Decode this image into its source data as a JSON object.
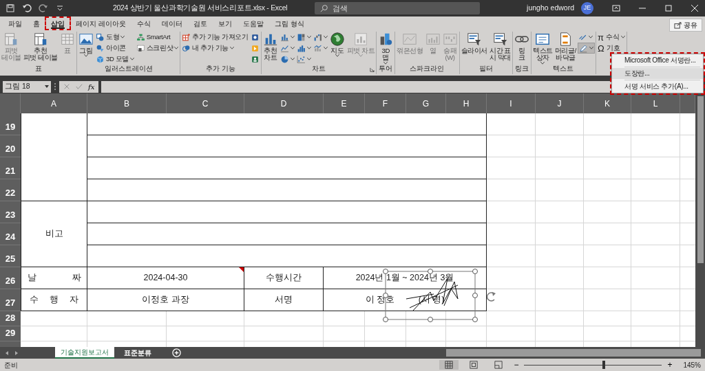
{
  "title_bar": {
    "title": "2024 상반기 울산과학기술원 서비스리포트.xlsx  -  Excel",
    "search_placeholder": "검색",
    "user_name": "jungho edword",
    "avatar_initials": "JE"
  },
  "ribbon_tabs": [
    {
      "label": "파일",
      "selected": false,
      "marked": false
    },
    {
      "label": "홈",
      "selected": false,
      "marked": false
    },
    {
      "label": "삽입",
      "selected": true,
      "marked": true
    },
    {
      "label": "페이지 레이아웃",
      "selected": false,
      "marked": false
    },
    {
      "label": "수식",
      "selected": false,
      "marked": false
    },
    {
      "label": "데이터",
      "selected": false,
      "marked": false
    },
    {
      "label": "검토",
      "selected": false,
      "marked": false
    },
    {
      "label": "보기",
      "selected": false,
      "marked": false
    },
    {
      "label": "도움말",
      "selected": false,
      "marked": false
    },
    {
      "label": "그림 형식",
      "selected": false,
      "marked": false
    }
  ],
  "share_button": "공유",
  "ribbon_groups": [
    {
      "label": "표",
      "items": [
        {
          "kind": "large",
          "label": "피벗\n테이블",
          "disabled": true,
          "dropdown": false
        },
        {
          "kind": "large",
          "label": "추천\n피벗 테이블",
          "disabled": false,
          "dropdown": false
        },
        {
          "kind": "large",
          "label": "표",
          "disabled": true,
          "dropdown": false
        }
      ]
    },
    {
      "label": "일러스트레이션",
      "items": [
        {
          "kind": "large",
          "label": "그림",
          "disabled": false,
          "dropdown": true
        },
        {
          "kind": "stack",
          "items": [
            {
              "label": "도형",
              "dropdown": true,
              "pressed": false
            },
            {
              "label": "아이콘",
              "dropdown": false,
              "pressed": false
            },
            {
              "label": "3D 모델",
              "dropdown": true,
              "pressed": false
            }
          ]
        },
        {
          "kind": "stack",
          "items": [
            {
              "label": "SmartArt",
              "dropdown": false,
              "pressed": false
            },
            {
              "label": "스크린샷",
              "dropdown": true,
              "pressed": false
            }
          ]
        }
      ]
    },
    {
      "label": "추가 기능",
      "items": [
        {
          "kind": "stack",
          "items": [
            {
              "label": "추가 기능 가져오기",
              "dropdown": false,
              "pressed": false
            },
            {
              "label": "내 추가 기능",
              "dropdown": true,
              "pressed": false
            }
          ]
        },
        {
          "kind": "stack",
          "items": [
            {
              "dropdown": false,
              "pressed": false
            },
            {
              "dropdown": false,
              "pressed": false
            },
            {
              "dropdown": false,
              "pressed": false
            }
          ]
        }
      ]
    },
    {
      "label": "차트",
      "launcher": true,
      "items": [
        {
          "kind": "large",
          "label": "추천\n차트",
          "disabled": false,
          "dropdown": false
        },
        {
          "kind": "stack",
          "items": [
            {
              "dropdown": true,
              "pressed": false
            },
            {
              "dropdown": true,
              "pressed": false
            },
            {
              "dropdown": true,
              "pressed": false
            }
          ]
        },
        {
          "kind": "stack",
          "items": [
            {
              "dropdown": true,
              "pressed": false
            },
            {
              "dropdown": true,
              "pressed": false
            },
            {
              "dropdown": true,
              "pressed": false
            }
          ]
        },
        {
          "kind": "stack",
          "items": [
            {
              "dropdown": true,
              "pressed": false
            },
            {
              "dropdown": true,
              "pressed": false
            }
          ]
        },
        {
          "kind": "large",
          "label": "지도",
          "disabled": false,
          "dropdown": true
        },
        {
          "kind": "large",
          "label": "피벗 차트",
          "disabled": true,
          "dropdown": true
        }
      ]
    },
    {
      "label": "투어",
      "items": [
        {
          "kind": "large",
          "label": "3D\n맵",
          "disabled": false,
          "dropdown": true
        }
      ]
    },
    {
      "label": "스파크라인",
      "items": [
        {
          "kind": "large",
          "label": "꺾은선형",
          "disabled": true,
          "dropdown": false
        },
        {
          "kind": "large",
          "label": "열",
          "disabled": true,
          "dropdown": false
        },
        {
          "kind": "large",
          "label": "승패\n(W)",
          "disabled": true,
          "dropdown": false
        }
      ]
    },
    {
      "label": "필터",
      "items": [
        {
          "kind": "large",
          "label": "슬라이서",
          "disabled": false,
          "dropdown": false
        },
        {
          "kind": "large",
          "label": "시간 표\n시 막대",
          "disabled": false,
          "dropdown": false
        }
      ]
    },
    {
      "label": "링크",
      "items": [
        {
          "kind": "large",
          "label": "링\n크",
          "disabled": false,
          "dropdown": false
        }
      ]
    },
    {
      "label": "텍스트",
      "items": [
        {
          "kind": "large",
          "label": "텍스트\n상자",
          "disabled": false,
          "dropdown": true
        },
        {
          "kind": "large",
          "label": "머리글/\n바닥글",
          "disabled": false,
          "dropdown": false
        },
        {
          "kind": "stack",
          "items": [
            {
              "dropdown": true,
              "pressed": false
            },
            {
              "dropdown": true,
              "pressed": true
            }
          ]
        }
      ]
    },
    {
      "items": [
        {
          "kind": "stack",
          "items": [
            {
              "symbol": "π",
              "label": "수식",
              "dropdown": true,
              "pressed": false
            },
            {
              "symbol": "Ω",
              "label": "기호",
              "dropdown": false,
              "pressed": false
            }
          ]
        }
      ]
    }
  ],
  "dropdown_menu": {
    "marked": true,
    "items": [
      {
        "label": "Microsoft Office 서명란...",
        "selected": false
      },
      {
        "label": "도장란...",
        "selected": true
      },
      {
        "label": "서명 서비스 추가(A)...",
        "selected": false
      }
    ]
  },
  "formula_bar": {
    "name_box": "그림 18",
    "function_label": "fx"
  },
  "sheet": {
    "columns": [
      "A",
      "B",
      "C",
      "D",
      "E",
      "F",
      "G",
      "H",
      "I",
      "J",
      "K",
      "L"
    ],
    "row_numbers": [
      "19",
      "20",
      "21",
      "22",
      "23",
      "24",
      "25",
      "26",
      "27",
      "28",
      "29"
    ],
    "cells": [
      {
        "text": "비고",
        "comment": false
      },
      {
        "text": "날　　　　짜",
        "comment": false
      },
      {
        "text": "2024-04-30",
        "comment": true
      },
      {
        "text": "수행시간",
        "comment": false
      },
      {
        "text": "2024년 1월 ~ 2024년 3월",
        "comment": false
      },
      {
        "text": "수　 행　 자",
        "comment": false
      },
      {
        "text": "이정호 과장",
        "comment": false
      },
      {
        "text": "서명",
        "comment": false
      },
      {
        "text": "이 정호          (서 명)",
        "comment": false
      }
    ],
    "signature_image": {
      "selected": true
    }
  },
  "sheet_tabs": [
    {
      "label": "기술지원보고서",
      "selected": true
    },
    {
      "label": "표준분류",
      "selected": false
    }
  ],
  "status_bar": {
    "status": "준비",
    "views": [
      {
        "selected": true
      },
      {
        "selected": false
      },
      {
        "selected": false
      }
    ],
    "zoom_out": "−",
    "zoom_in": "+",
    "zoom_slider": {
      "level": 0.58
    },
    "zoom": "145%"
  }
}
